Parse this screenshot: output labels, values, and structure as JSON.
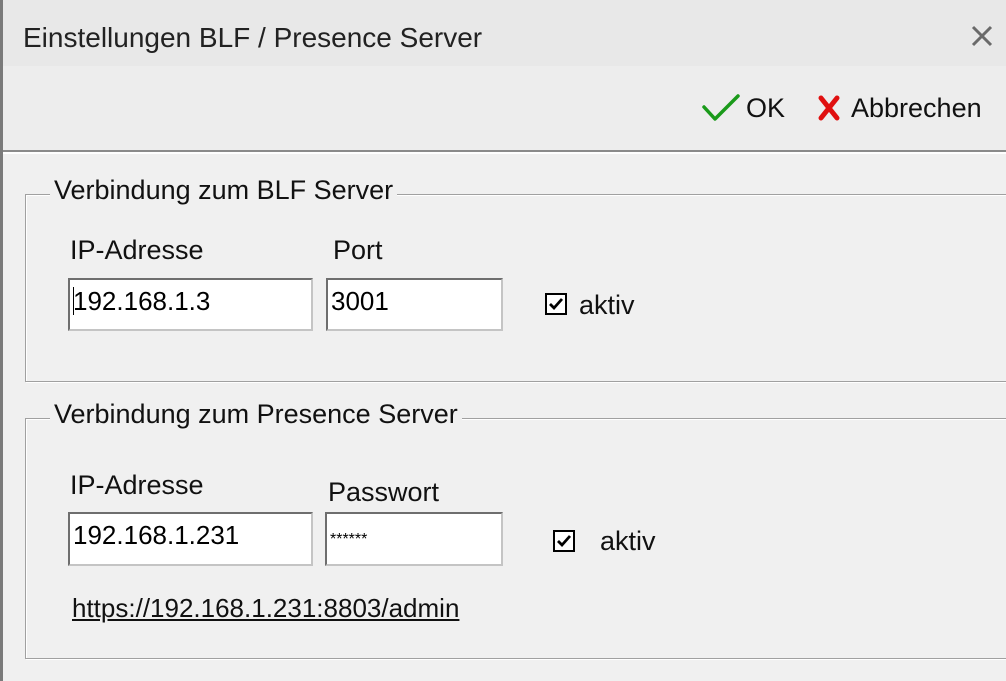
{
  "window": {
    "title": "Einstellungen BLF / Presence Server",
    "close_icon": "close-icon"
  },
  "toolbar": {
    "ok_label": "OK",
    "cancel_label": "Abbrechen",
    "ok_icon": "checkmark-icon",
    "cancel_icon": "red-x-icon",
    "ok_color": "#1a9a1a",
    "cancel_color": "#e01010"
  },
  "blf": {
    "legend": "Verbindung zum BLF Server",
    "ip_label": "IP-Adresse",
    "ip_value": "192.168.1.3",
    "port_label": "Port",
    "port_value": "3001",
    "active_label": "aktiv",
    "active_checked": true
  },
  "presence": {
    "legend": "Verbindung zum Presence Server",
    "ip_label": "IP-Adresse",
    "ip_value": "192.168.1.231",
    "password_label": "Passwort",
    "password_value": "******",
    "active_label": "aktiv",
    "active_checked": true,
    "admin_link": "https://192.168.1.231:8803/admin"
  }
}
